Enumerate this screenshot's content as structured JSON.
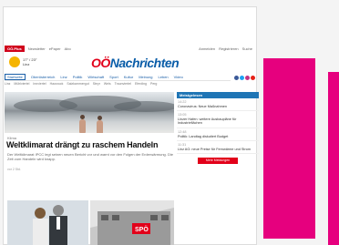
{
  "colors": {
    "accent": "#e6007e",
    "brand_red": "#e2001a",
    "brand_blue": "#0a5da8",
    "sidebar_head": "#1f75b5"
  },
  "topbar": {
    "badge": "OÖ.Plus",
    "links": [
      "Newsletter",
      "ePaper",
      "Abo"
    ],
    "right_links": [
      "Anmelden",
      "Registrieren",
      "Suche"
    ]
  },
  "weather": {
    "temp": "17° / 23°",
    "place": "Linz"
  },
  "logo": {
    "oo": "OÖ",
    "rest": "Nachrichten"
  },
  "nav": {
    "items": [
      "Startseite",
      "Oberösterreich",
      "Linz",
      "Politik",
      "Wirtschaft",
      "Sport",
      "Kultur",
      "Meinung",
      "Leben",
      "Video"
    ]
  },
  "subnav": {
    "items": [
      "Linz",
      "Mühlviertel",
      "Innviertel",
      "Hausruck",
      "Salzkammergut",
      "Steyr",
      "Wels",
      "Traunviertel",
      "Eferding",
      "Perg"
    ]
  },
  "article": {
    "kicker": "Klima",
    "headline": "Weltklimarat drängt zu raschem Handeln",
    "teaser": "Der Weltklimarat IPCC legt seinen neuen Bericht vor und warnt vor den Folgen der Erderwärmung. Die Zeit zum Handeln wird knapp.",
    "meta": "vor 2 Std."
  },
  "sidebar": {
    "title": "Meistgelesen",
    "items": [
      {
        "time": "14:22",
        "text": "Coronavirus: Neue Maßnahmen"
      },
      {
        "time": "13:05",
        "text": "Linzer Hafen: weitere Ausbaupläne für Industrieflächen"
      },
      {
        "time": "12:48",
        "text": "Politik: Landtag diskutiert Budget"
      },
      {
        "time": "11:31",
        "text": "Linz AG: neue Preise für Fernwärme und Strom"
      }
    ],
    "button": "Mehr Meldungen"
  },
  "images": {
    "right_sign": "SPÖ"
  }
}
